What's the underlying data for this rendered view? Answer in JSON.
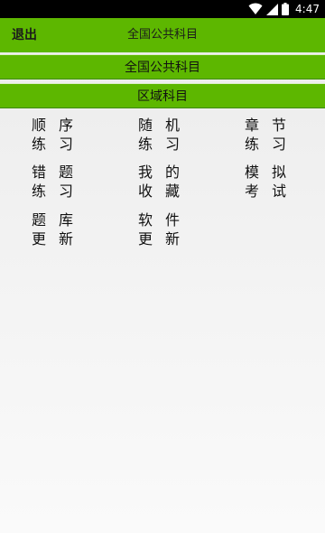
{
  "status_bar": {
    "time": "4:47",
    "icons": [
      "wifi-icon",
      "cellular-signal-icon",
      "battery-icon"
    ]
  },
  "header": {
    "exit_label": "退出",
    "title": "全国公共科目"
  },
  "subjects": {
    "national_label": "全国公共科目",
    "regional_label": "区域科目"
  },
  "menu": [
    {
      "line1": "顺序",
      "line2": "练习"
    },
    {
      "line1": "随机",
      "line2": "练习"
    },
    {
      "line1": "章节",
      "line2": "练习"
    },
    {
      "line1": "错题",
      "line2": "练习"
    },
    {
      "line1": "我的",
      "line2": "收藏"
    },
    {
      "line1": "模拟",
      "line2": "考试"
    },
    {
      "line1": "题库",
      "line2": "更新"
    },
    {
      "line1": "软件",
      "line2": "更新"
    }
  ],
  "colors": {
    "accent_green": "#5db700",
    "status_bar": "#000000",
    "text": "#111111"
  }
}
